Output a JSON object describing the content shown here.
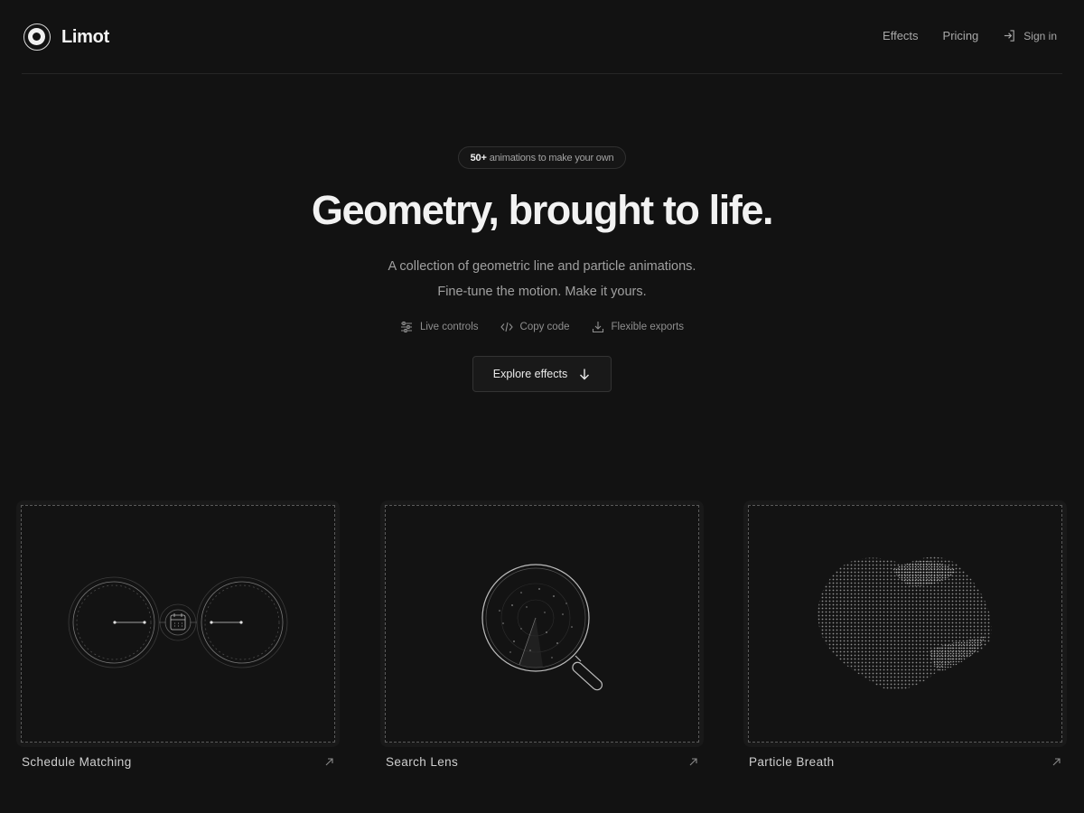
{
  "brand": {
    "name": "Limot",
    "logo_icon": "concentric-circle-logo"
  },
  "nav": {
    "effects_label": "Effects",
    "pricing_label": "Pricing",
    "signin_label": "Sign in",
    "signin_icon": "sign-in-icon"
  },
  "hero": {
    "badge_count": "50+",
    "badge_text": "animations to make your own",
    "headline": "Geometry, brought to life.",
    "subtitle_line1": "A collection of geometric line and particle animations.",
    "subtitle_line2": "Fine-tune the motion. Make it yours.",
    "features": [
      {
        "icon": "sliders-icon",
        "label": "Live controls"
      },
      {
        "icon": "code-icon",
        "label": "Copy code"
      },
      {
        "icon": "download-icon",
        "label": "Flexible exports"
      }
    ],
    "cta_label": "Explore effects",
    "cta_icon": "arrow-down-icon"
  },
  "cards": [
    {
      "title": "Schedule Matching",
      "icon": "arrow-up-right-icon"
    },
    {
      "title": "Search Lens",
      "icon": "arrow-up-right-icon"
    },
    {
      "title": "Particle Breath",
      "icon": "arrow-up-right-icon"
    }
  ],
  "colors": {
    "background": "#121212",
    "card": "#191919",
    "text": "#f2f2f2",
    "muted": "#a0a0a0"
  }
}
